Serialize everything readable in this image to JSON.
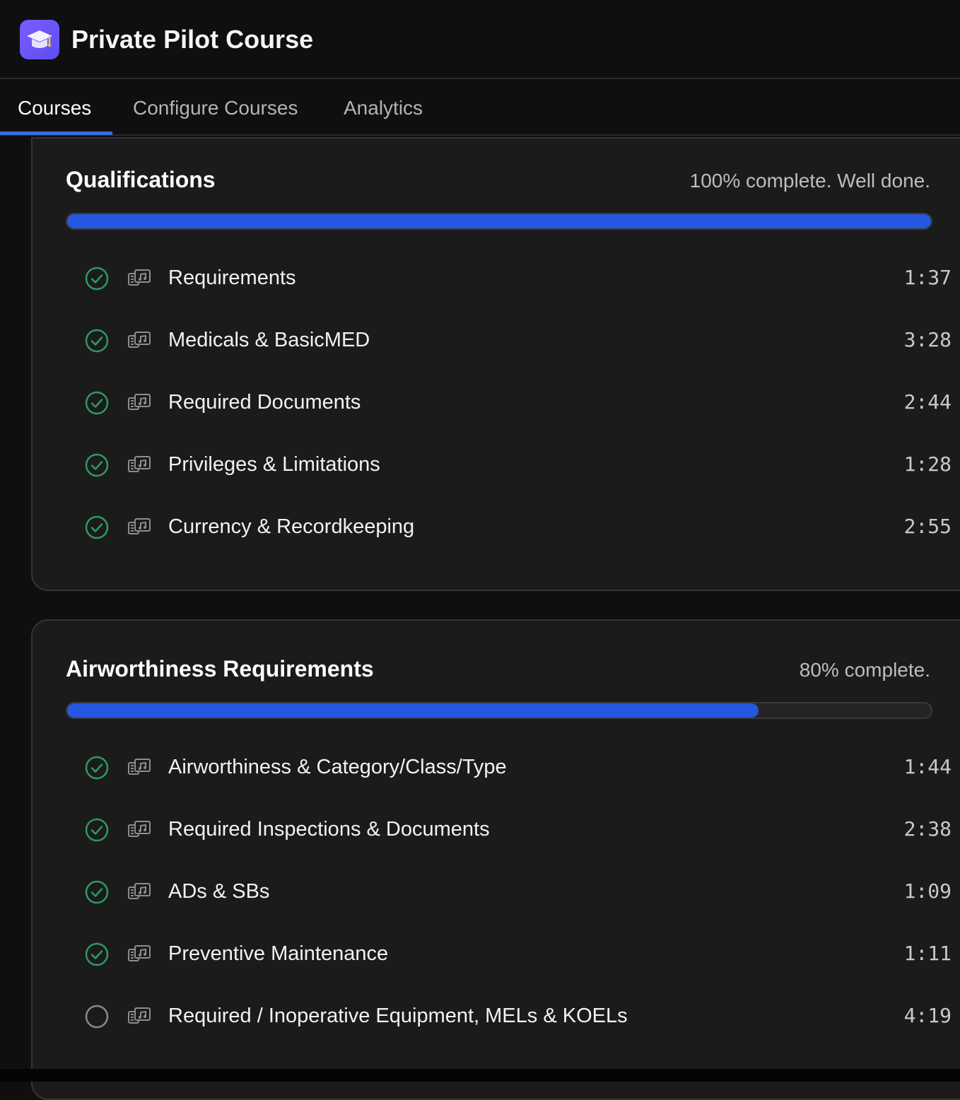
{
  "app": {
    "title": "Private Pilot Course",
    "icon": "graduation-cap-icon"
  },
  "tabs": [
    {
      "label": "Courses",
      "active": true
    },
    {
      "label": "Configure Courses",
      "active": false
    },
    {
      "label": "Analytics",
      "active": false
    }
  ],
  "colors": {
    "accent": "#2458e0",
    "complete": "#2e9a5e",
    "background": "#0f0f10",
    "card": "#1b1b1c"
  },
  "sections": [
    {
      "title": "Qualifications",
      "status": "100% complete. Well done.",
      "progress": 1.0,
      "lessons": [
        {
          "name": "Requirements",
          "duration": "1:37",
          "completed": true,
          "icon": "audio-video-icon"
        },
        {
          "name": "Medicals & BasicMED",
          "duration": "3:28",
          "completed": true,
          "icon": "audio-video-icon"
        },
        {
          "name": "Required Documents",
          "duration": "2:44",
          "completed": true,
          "icon": "audio-video-icon"
        },
        {
          "name": "Privileges & Limitations",
          "duration": "1:28",
          "completed": true,
          "icon": "audio-video-icon"
        },
        {
          "name": "Currency & Recordkeeping",
          "duration": "2:55",
          "completed": true,
          "icon": "audio-video-icon"
        }
      ]
    },
    {
      "title": "Airworthiness Requirements",
      "status": "80% complete.",
      "progress": 0.8,
      "lessons": [
        {
          "name": "Airworthiness & Category/Class/Type",
          "duration": "1:44",
          "completed": true,
          "icon": "audio-video-icon"
        },
        {
          "name": "Required Inspections & Documents",
          "duration": "2:38",
          "completed": true,
          "icon": "audio-video-icon"
        },
        {
          "name": "ADs & SBs",
          "duration": "1:09",
          "completed": true,
          "icon": "audio-video-icon"
        },
        {
          "name": "Preventive Maintenance",
          "duration": "1:11",
          "completed": true,
          "icon": "audio-video-icon"
        },
        {
          "name": "Required / Inoperative Equipment, MELs & KOELs",
          "duration": "4:19",
          "completed": false,
          "icon": "audio-video-icon"
        }
      ]
    }
  ]
}
